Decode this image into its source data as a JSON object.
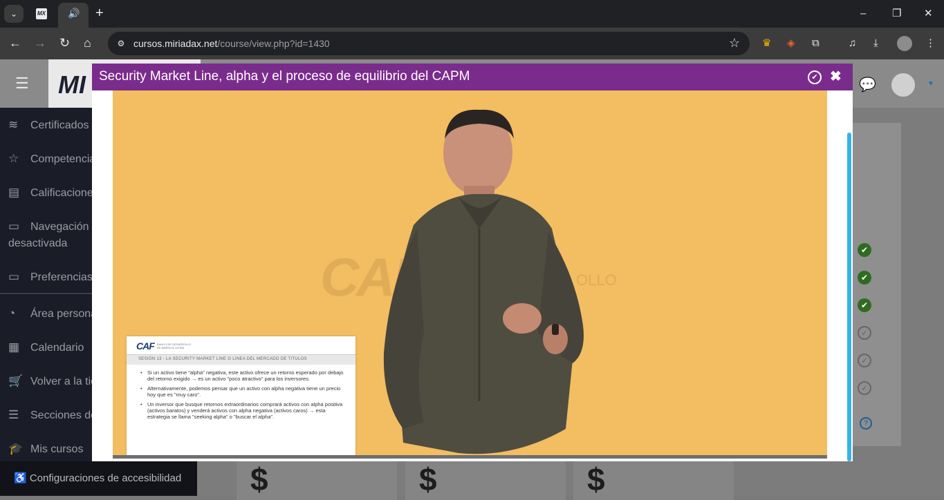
{
  "browser": {
    "tab_favicon_label": "MX",
    "new_tab_symbol": "+",
    "url_host": "cursos.miriadax.net",
    "url_path": "/course/view.php?id=1430"
  },
  "page": {
    "logo_text": "MI",
    "sidebar": {
      "items": [
        {
          "icon": "layers-icon",
          "label": "Certificados"
        },
        {
          "icon": "star-icon",
          "label": "Competencias"
        },
        {
          "icon": "book-icon",
          "label": "Calificaciones"
        },
        {
          "icon": "folder-icon",
          "label": "Navegación"
        },
        {
          "icon": "",
          "label": "desactivada"
        },
        {
          "icon": "folder-icon",
          "label": "Preferencias"
        },
        {
          "icon": "dashboard-icon",
          "label": "Área personal"
        },
        {
          "icon": "calendar-icon",
          "label": "Calendario"
        },
        {
          "icon": "cart-icon",
          "label": "Volver a la tienda"
        },
        {
          "icon": "list-icon",
          "label": "Secciones del curso"
        },
        {
          "icon": "hat-icon",
          "label": "Mis cursos"
        }
      ],
      "accessibility_label": "Configuraciones de accesibilidad"
    },
    "activity_status": [
      "done",
      "done",
      "done",
      "todo",
      "todo",
      "todo"
    ],
    "cards_symbol": "$"
  },
  "modal": {
    "title": "Security Market Line, alpha y el proceso de equilibrio del CAPM",
    "video": {
      "watermark": "CAF",
      "watermark_suffix": "OLLO",
      "slide": {
        "logo": "CAF",
        "logo_sub_1": "BANCO DE DESARROLLO",
        "logo_sub_2": "DE AMÉRICA LATINA",
        "heading": "SESIÓN 13 - LA SECURITY MARKET LINE O LINEA DEL MERCADO DE TITULOS",
        "bullets": [
          "Si un activo tiene \"alpha\" negativa, este activo ofrece un retorno esperado por debajo del retorno exigido → es un activo \"poco atractivo\" para los inversores.",
          "Alternativamente, podemos pensar que un activo con alpha negativa tiene un precio hoy que es \"muy caro\".",
          "Un inversor que busque retornos extraordinarios comprará activos con alpha positiva (activos baratos) y venderá activos con alpha negativa (activos caros) → esta estrategia se llama \"seeking alpha\" o \"buscar el alpha\"."
        ]
      }
    }
  }
}
